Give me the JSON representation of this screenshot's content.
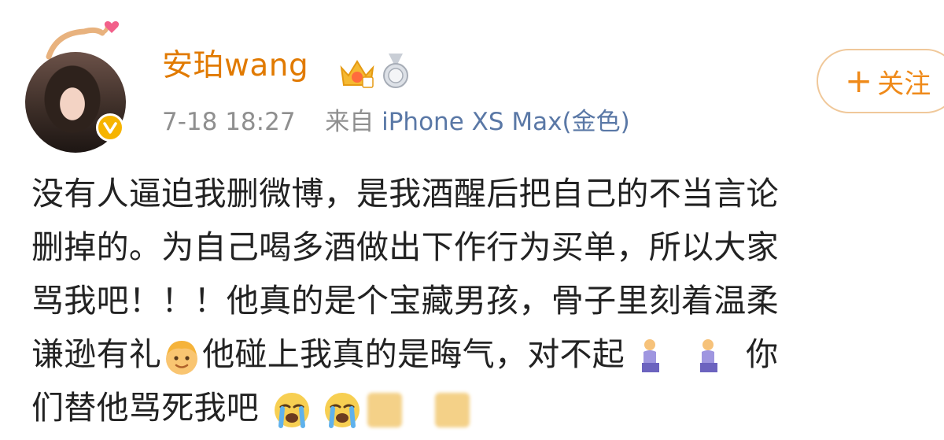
{
  "post": {
    "author": {
      "name": "安珀wang",
      "avatar_icon": "user-avatar-photo",
      "badges": [
        "crown-vip-icon",
        "medal-icon",
        "verified-icon"
      ]
    },
    "meta": {
      "timestamp": "7-18 18:27",
      "source_prefix": "来自",
      "device": "iPhone XS Max(金色)"
    },
    "follow_button": {
      "plus": "+",
      "label": "关注"
    },
    "content_lines": [
      {
        "text": "没有人逼迫我删微博，是我酒醒后把自己的不当言论"
      },
      {
        "text": "删掉的。为自己喝多酒做出下作行为买单，所以大家"
      },
      {
        "text": "骂我吧！！！他真的是个宝藏男孩，骨子里刻着温柔"
      },
      {
        "before": "谦逊有礼",
        "after": "他碰上我真的是晦气，对不起",
        "trail": "你"
      },
      {
        "text": "们替他骂死我吧"
      }
    ]
  },
  "colors": {
    "username": "#e17a00",
    "device_link": "#5a78a6",
    "timestamp": "#8f8f8f",
    "follow_text": "#ef8a1a",
    "follow_border": "#f0c89a",
    "verified_badge": "#f6b400"
  }
}
